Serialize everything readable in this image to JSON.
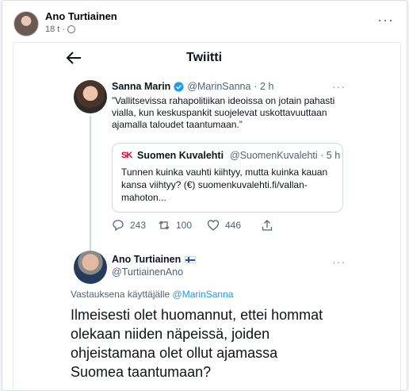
{
  "post": {
    "author": "Ano Turtiainen",
    "time": "18 t",
    "separator": "·",
    "more_label": "···"
  },
  "screenshot": {
    "header_title": "Twiitti",
    "original_tweet": {
      "name": "Sanna Marin",
      "handle": "@MarinSanna",
      "time": "· 2 h",
      "text": "”Vallitsevissa rahapolitiikan ideoissa on jotain pahasti vialla, kun keskuspankit suojelevat uskottavuuttaan ajamalla taloudet taantumaan.”",
      "more_label": "···"
    },
    "quoted_tweet": {
      "logo": "SK",
      "name": "Suomen Kuvalehti",
      "handle": "@SuomenKuvalehti · 5 h",
      "text": "Tunnen kuinka vauhti kiihtyy, mutta kuinka kauan kansa viihtyy? (€) suomenkuvalehti.fi/vallan-mahoton..."
    },
    "actions": {
      "replies": "243",
      "retweets": "100",
      "likes": "446"
    },
    "reply_tweet": {
      "name": "Ano Turtiainen",
      "handle": "@TurtiainenAno",
      "more_label": "···",
      "reply_prefix": "Vastauksena käyttäjälle",
      "reply_mention": "@MarinSanna",
      "text": "Ilmeisesti olet huomannut, ettei hommat olekaan niiden näpeissä, joiden ohjeistamana olet ollut ajamassa Suomea taantumaan?"
    },
    "icons": {
      "back": "arrow-left-icon",
      "verified": "verified-badge-icon",
      "reply": "reply-icon",
      "retweet": "retweet-icon",
      "like": "heart-icon",
      "share": "share-icon",
      "globe": "globe-icon",
      "flag": "finland-flag-icon"
    },
    "colors": {
      "accent": "#1d9bf0",
      "sk_logo": "#e4002b"
    }
  }
}
